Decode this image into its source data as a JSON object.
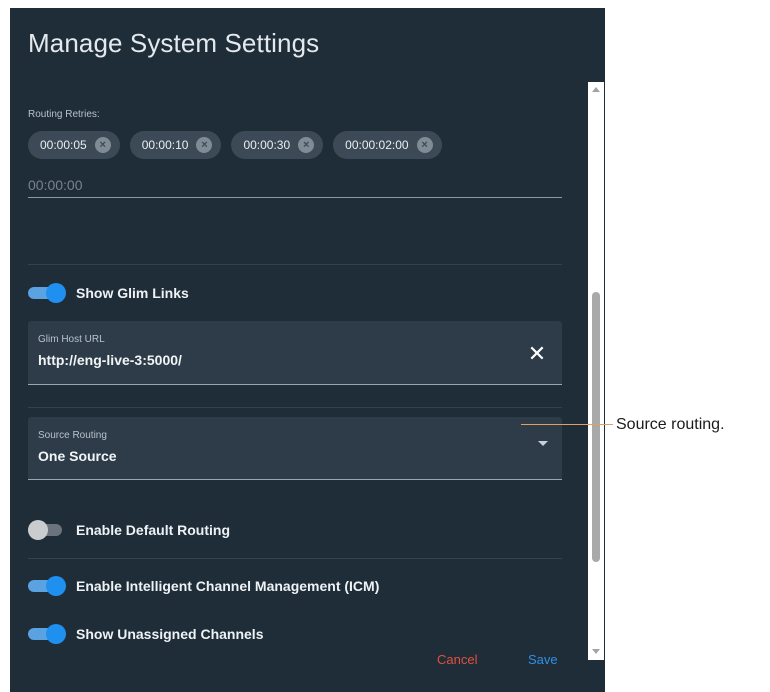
{
  "dialog": {
    "title": "Manage System Settings"
  },
  "routing_retries": {
    "label": "Routing Retries:",
    "chips": [
      "00:00:05",
      "00:00:10",
      "00:00:30",
      "00:00:02:00"
    ],
    "input_placeholder": "00:00:00",
    "input_value": ""
  },
  "toggles": {
    "show_glim_links": {
      "label": "Show Glim Links",
      "on": true
    },
    "enable_default_routing": {
      "label": "Enable Default Routing",
      "on": false
    },
    "enable_icm": {
      "label": "Enable Intelligent Channel Management (ICM)",
      "on": true
    },
    "show_unassigned_channels": {
      "label": "Show Unassigned Channels",
      "on": true
    }
  },
  "glim_host": {
    "label": "Glim Host URL",
    "value": "http://eng-live-3:5000/",
    "clear_icon": "close-icon"
  },
  "source_routing": {
    "label": "Source Routing",
    "value": "One Source",
    "icon": "caret-down-icon"
  },
  "actions": {
    "cancel": "Cancel",
    "save": "Save"
  },
  "annotation": {
    "text": "Source routing."
  },
  "colors": {
    "dialog_bg": "#1f2d38",
    "accent": "#1f8ff0",
    "cancel": "#e2503d",
    "save": "#2f8fe8"
  }
}
